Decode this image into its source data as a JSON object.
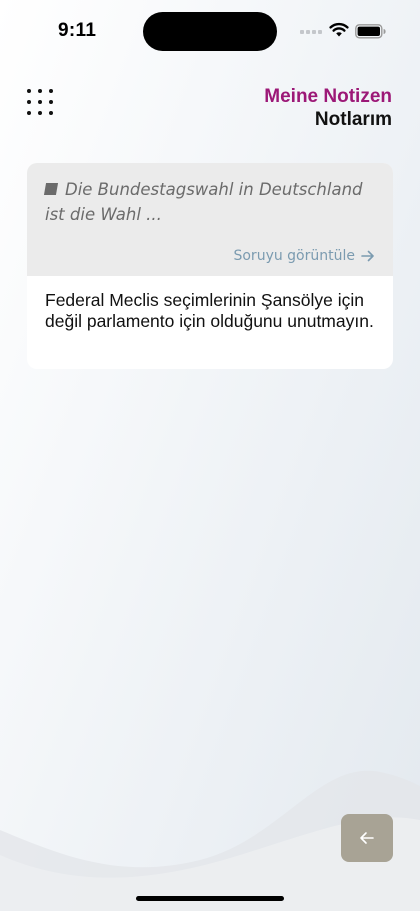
{
  "status_bar": {
    "time": "9:11"
  },
  "header": {
    "title_de": "Meine Notizen",
    "title_tr": "Notlarım",
    "menu_icon": "grid-dots-icon"
  },
  "note": {
    "question_text": "Die Bundestagswahl in Deutschland ist die Wahl ...",
    "view_question_label": "Soruyu görüntüle",
    "body_text": "Federal Meclis seçimlerinin Şansölye için değil parlamento için olduğunu unutmayın."
  },
  "footer": {
    "back_icon": "arrow-left-icon"
  },
  "colors": {
    "accent_magenta": "#9c1877",
    "link_blue": "#7b9bb0",
    "back_button_bg": "#a8a395",
    "question_bg": "#ebebeb"
  }
}
